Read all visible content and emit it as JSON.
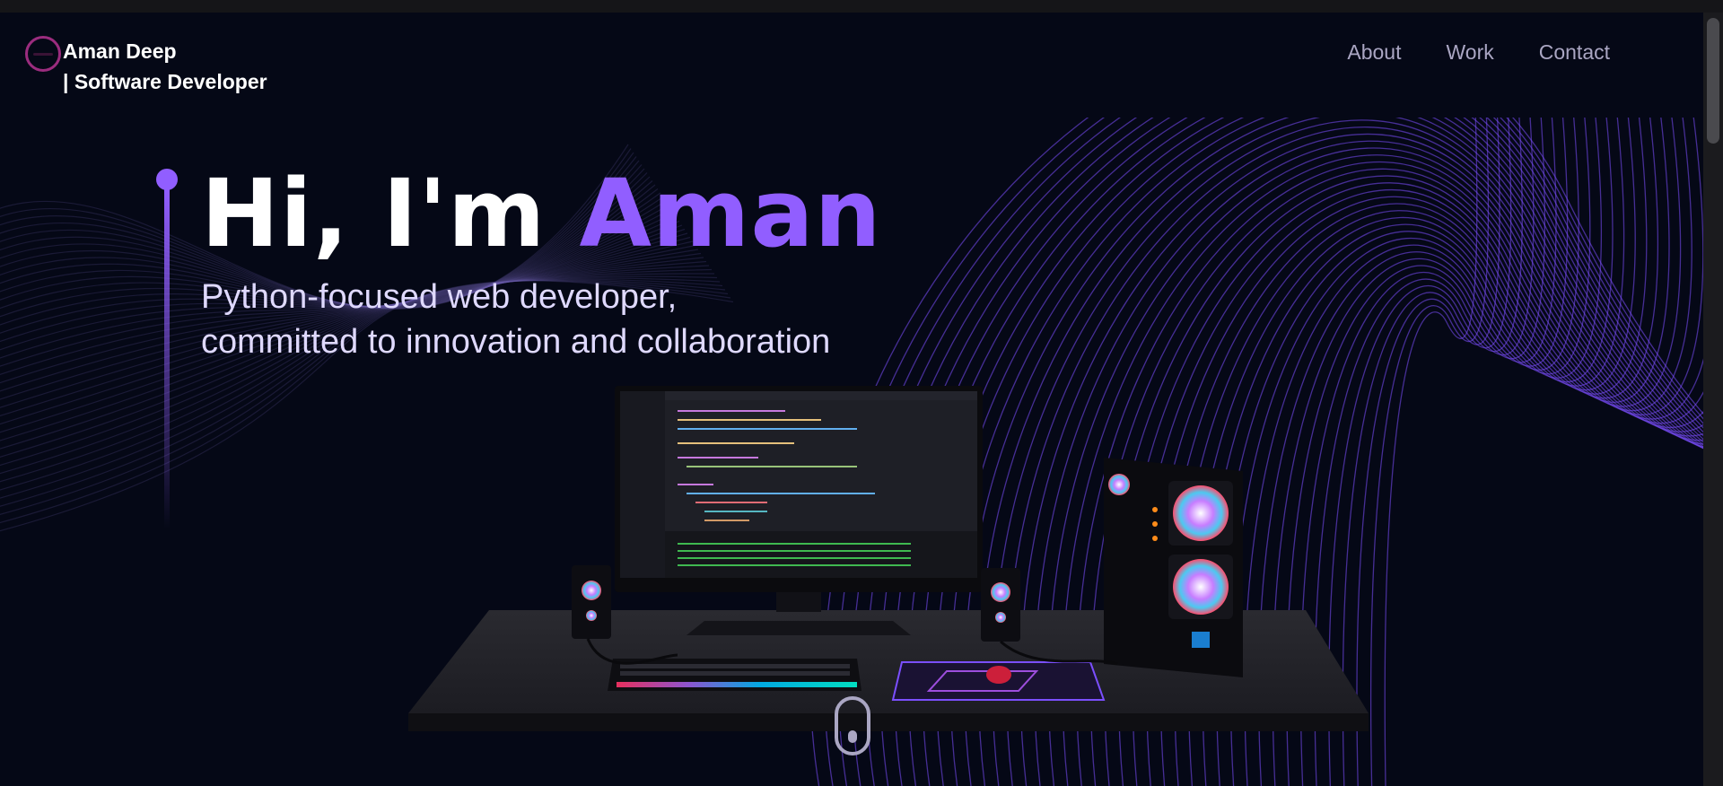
{
  "navbar": {
    "brand_line1": "Aman Deep",
    "brand_line2": "| Software Developer",
    "links": [
      {
        "label": "About"
      },
      {
        "label": "Work"
      },
      {
        "label": "Contact"
      }
    ]
  },
  "hero": {
    "title_prefix": "Hi, I'm ",
    "title_name": "Aman",
    "subtitle_line1": "Python-focused web developer,",
    "subtitle_line2": "committed to innovation and collaboration"
  },
  "colors": {
    "background": "#050816",
    "accent": "#915eff",
    "nav_text": "#aaa6c3",
    "subtitle_text": "#dfd9ff"
  }
}
